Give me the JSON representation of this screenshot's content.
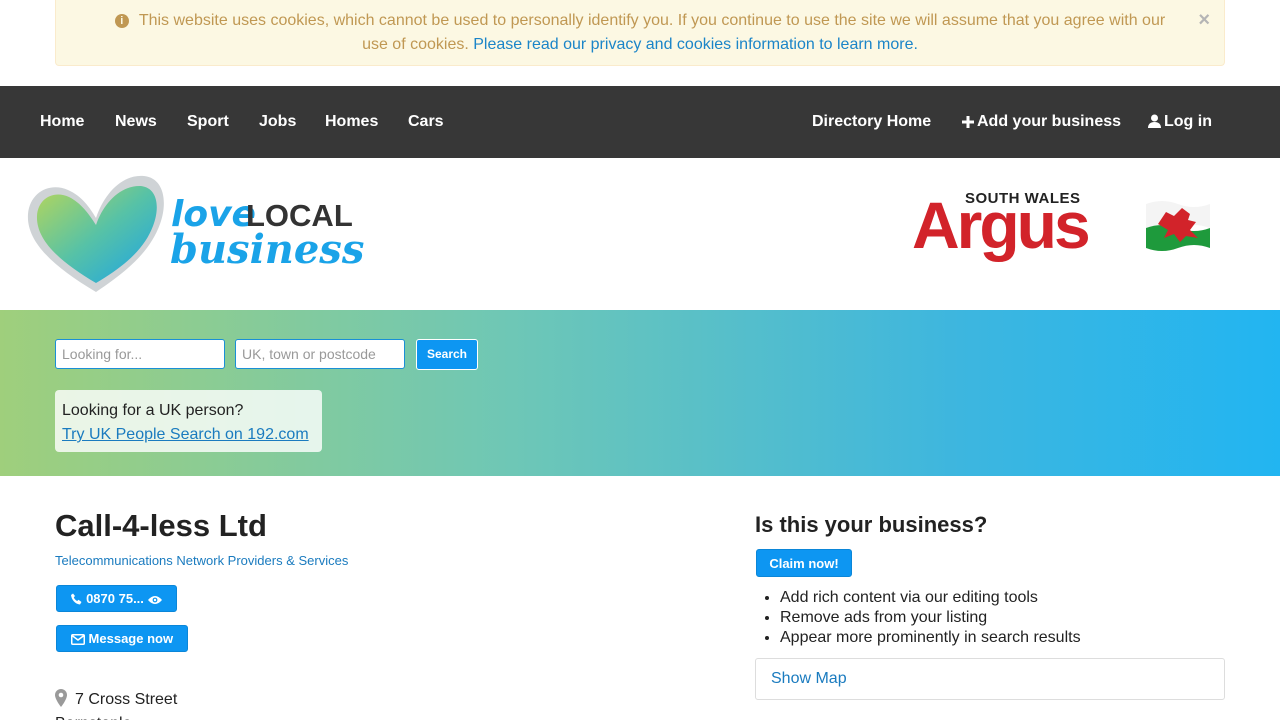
{
  "cookie_banner": {
    "message": "This website uses cookies, which cannot be used to personally identify you. If you continue to use the site we will assume that you agree with our use of cookies.",
    "link_text": "Please read our privacy and cookies information to learn more.",
    "close_label": "×"
  },
  "nav": {
    "left_items": [
      "Home",
      "News",
      "Sport",
      "Jobs",
      "Homes",
      "Cars"
    ],
    "directory_home": "Directory Home",
    "add_business": "Add your business",
    "log_in": "Log in"
  },
  "logos": {
    "love_local": {
      "love": "love",
      "local": "LOCAL",
      "business": "business"
    },
    "argus": {
      "south_wales": "SOUTH WALES",
      "argus": "Argus"
    }
  },
  "search": {
    "what_placeholder": "Looking for...",
    "where_placeholder": "UK, town or postcode",
    "button_label": "Search"
  },
  "people_search": {
    "question": "Looking for a UK person?",
    "link_text": "Try UK People Search on 192.com"
  },
  "business": {
    "name": "Call-4-less Ltd",
    "category": "Telecommunications Network Providers & Services",
    "phone_button": "0870 75...",
    "message_button": "Message now",
    "address_line1": "7 Cross Street",
    "address_line2": "Barnstaple"
  },
  "claim": {
    "title": "Is this your business?",
    "button": "Claim now!",
    "benefits": [
      "Add rich content via our editing tools",
      "Remove ads from your listing",
      "Appear more prominently in search results"
    ],
    "show_map": "Show Map"
  },
  "colors": {
    "nav_bg": "#373737",
    "accent_blue": "#0d96f2",
    "link_blue": "#1a7bbf",
    "cookie_bg": "#fcf8e3",
    "cookie_text": "#c09853",
    "argus_red": "#d2232a"
  },
  "icons": [
    "info-icon",
    "close-icon",
    "plus-icon",
    "user-icon",
    "phone-icon",
    "eye-icon",
    "envelope-icon",
    "map-marker-icon",
    "welsh-flag-icon",
    "heart-logo-icon"
  ]
}
